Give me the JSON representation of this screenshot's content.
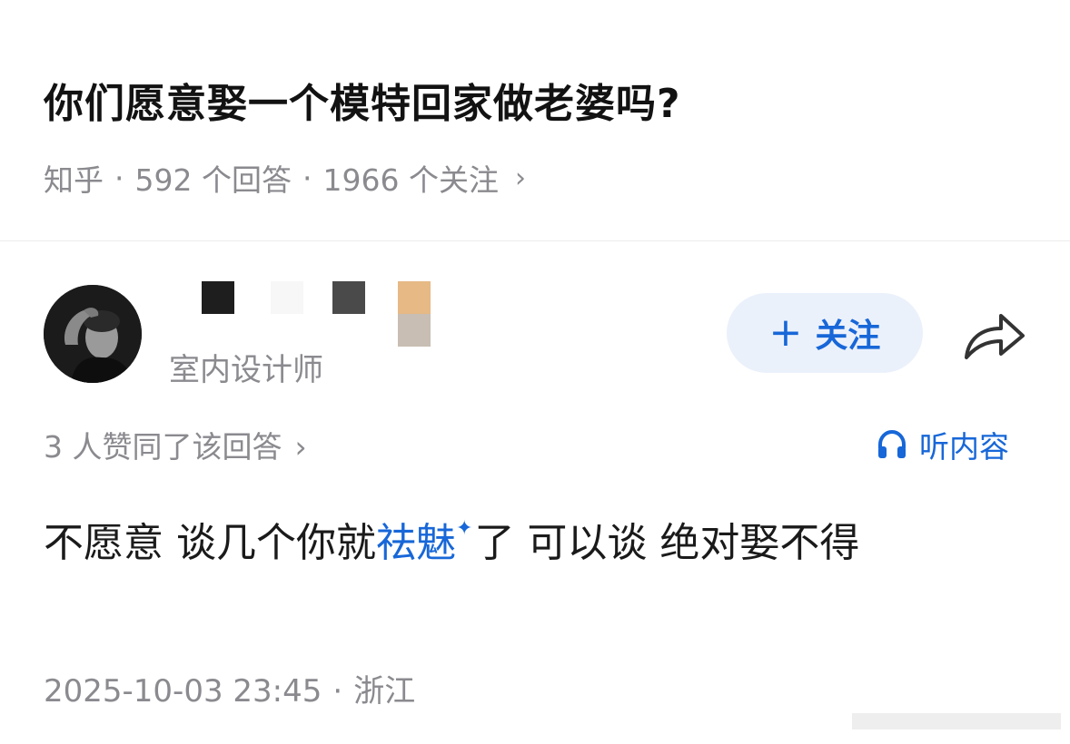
{
  "question": {
    "title": "你们愿意娶一个模特回家做老婆吗?",
    "source": "知乎",
    "answers": "592 个回答",
    "followers": "1966 个关注",
    "separator": "·",
    "chevron": "›"
  },
  "author": {
    "avatar_icon": "avatar-photo",
    "title": "室内设计师"
  },
  "actions": {
    "follow_plus": "+",
    "follow_label": "关注",
    "share_icon": "share-arrow-icon",
    "accent": "#1767d8",
    "follow_bg": "#ebf1fb"
  },
  "answer_meta": {
    "likes": "3 人赞同了该回答",
    "chevron": "›",
    "listen_label": "听内容",
    "listen_icon": "headphones-icon"
  },
  "answer": {
    "before": "不愿意 谈几个你就",
    "link": "祛魅",
    "sparkle": "✦",
    "after": "了 可以谈 绝对娶不得"
  },
  "footer": {
    "datetime": "2025-10-03 23:45",
    "separator": "·",
    "location": "浙江"
  }
}
